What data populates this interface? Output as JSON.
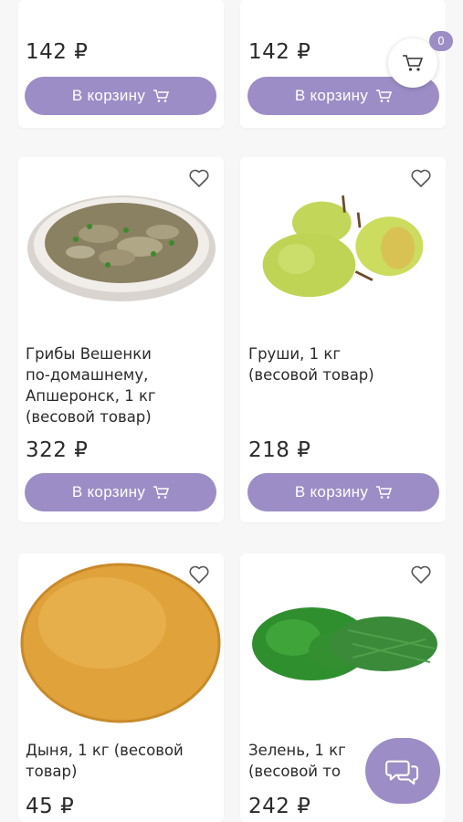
{
  "cart": {
    "count": "0"
  },
  "products": [
    {
      "price": "142 ₽",
      "button": "В корзину"
    },
    {
      "price": "142 ₽",
      "button": "В корзину"
    },
    {
      "name": "Грибы Вешенки\nпо-домашнему,\nАпшеронск, 1 кг\n(весовой товар)",
      "price": "322 ₽",
      "button": "В корзину"
    },
    {
      "name": "Груши, 1 кг\n(весовой товар)",
      "price": "218 ₽",
      "button": "В корзину"
    },
    {
      "name": "Дыня, 1 кг (весовой\nтовар)",
      "price": "45 ₽"
    },
    {
      "name": "Зелень, 1 кг\n(весовой то",
      "price": "242 ₽"
    }
  ],
  "colors": {
    "accent": "#9c8dc6",
    "background": "#f7f7f7"
  },
  "icons": [
    "cart-icon",
    "heart-icon",
    "chat-icon"
  ]
}
